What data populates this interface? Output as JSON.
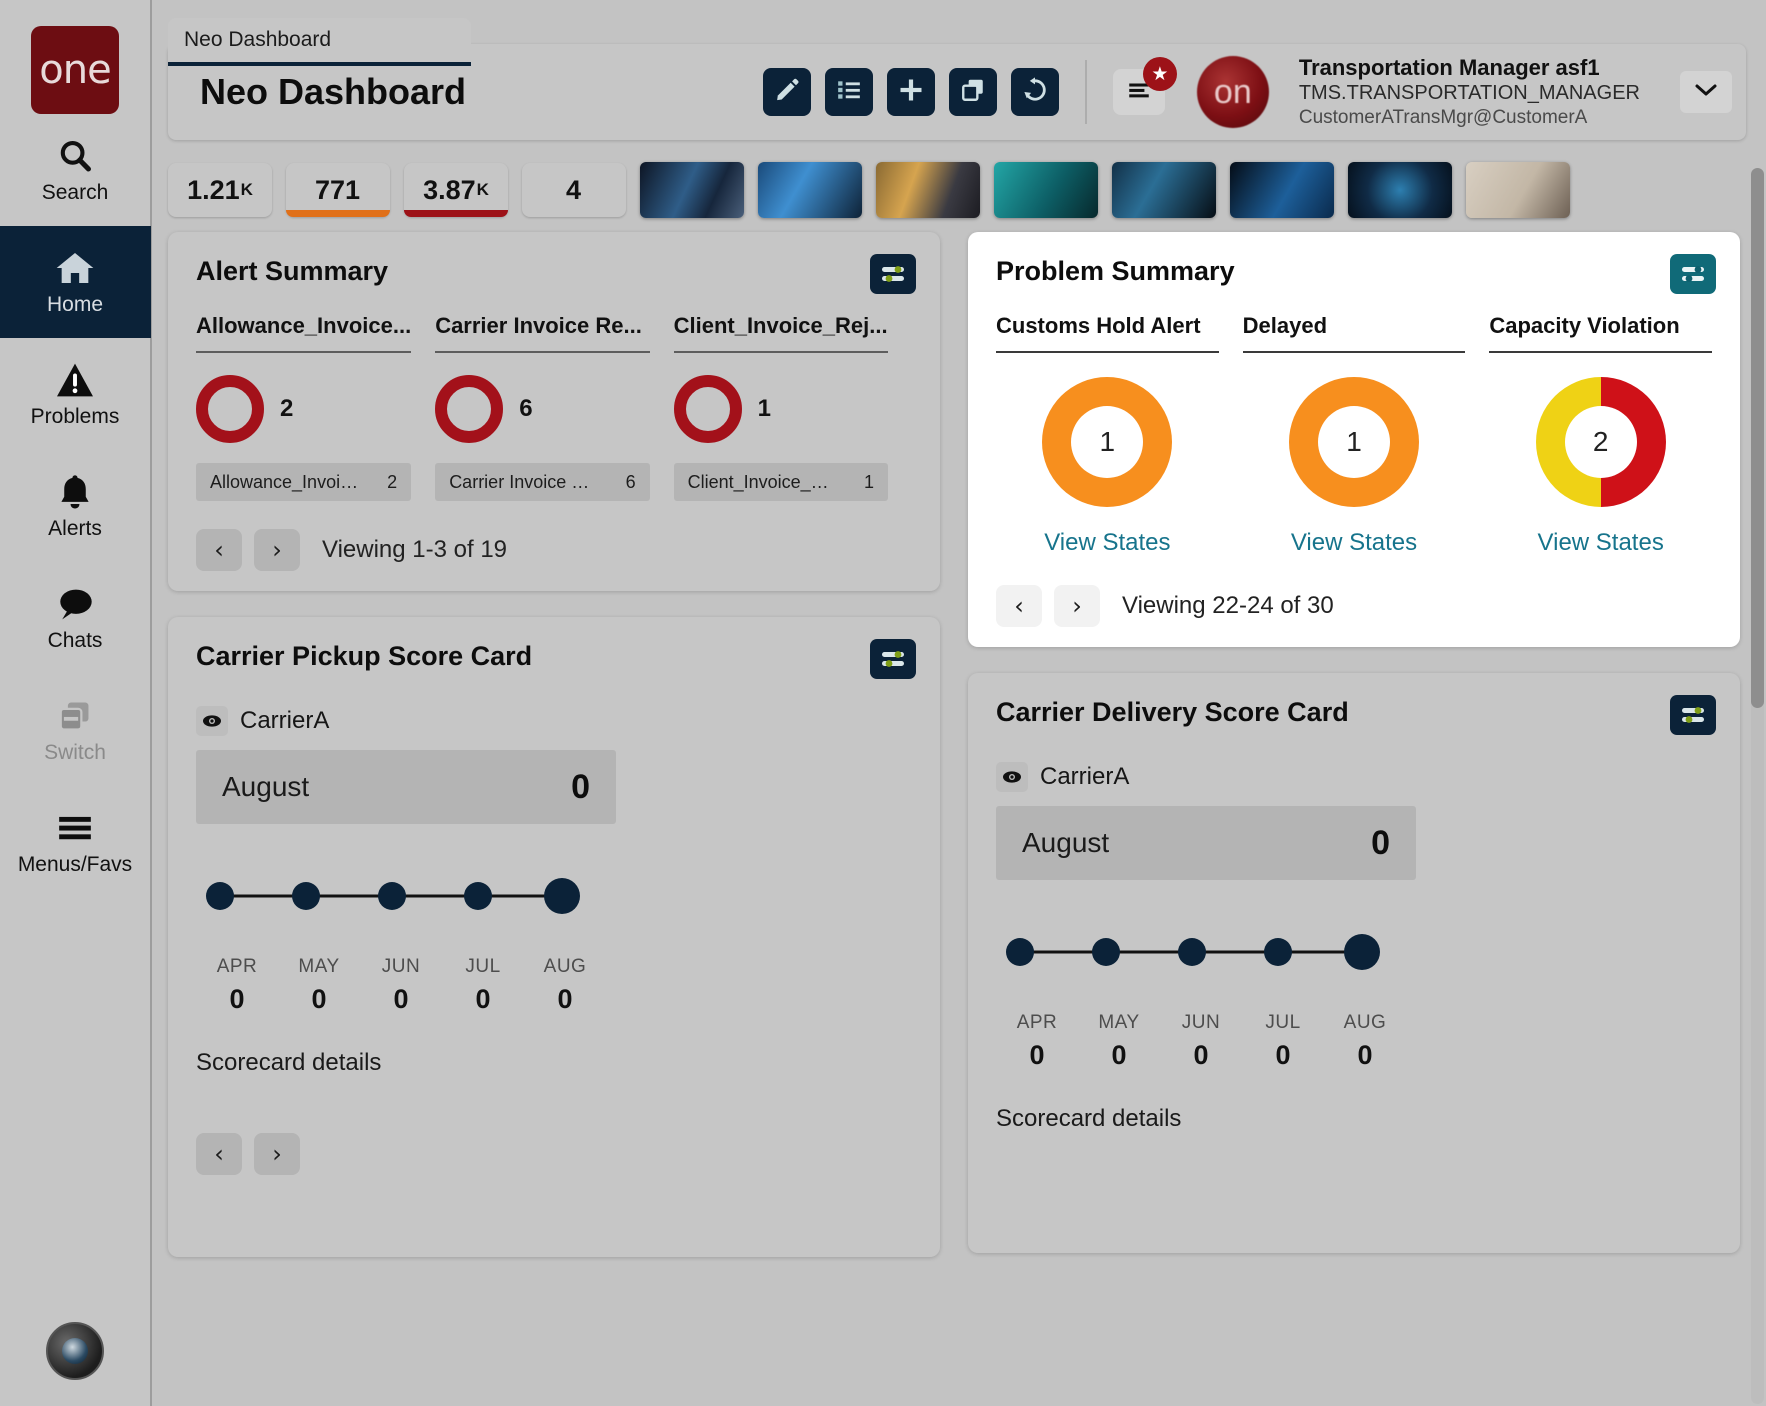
{
  "brand": {
    "logo_text": "one"
  },
  "rail": {
    "items": [
      {
        "label": "Search",
        "icon": "search-icon",
        "state": "normal"
      },
      {
        "label": "Home",
        "icon": "home-icon",
        "state": "active"
      },
      {
        "label": "Problems",
        "icon": "warning-icon",
        "state": "normal"
      },
      {
        "label": "Alerts",
        "icon": "bell-icon",
        "state": "normal"
      },
      {
        "label": "Chats",
        "icon": "chat-icon",
        "state": "normal"
      },
      {
        "label": "Switch",
        "icon": "switch-icon",
        "state": "disabled"
      },
      {
        "label": "Menus/Favs",
        "icon": "hamburger-icon",
        "state": "normal"
      }
    ]
  },
  "tab": {
    "label": "Neo Dashboard"
  },
  "header": {
    "title": "Neo Dashboard",
    "tools": [
      {
        "name": "edit-button",
        "icon": "pencil-icon"
      },
      {
        "name": "list-button",
        "icon": "list-icon"
      },
      {
        "name": "add-button",
        "icon": "plus-icon"
      },
      {
        "name": "copy-button",
        "icon": "copy-icon"
      },
      {
        "name": "refresh-button",
        "icon": "refresh-icon"
      }
    ],
    "menu_badge": "★",
    "user": {
      "avatar_text": "on",
      "name": "Transportation Manager asf1",
      "role": "TMS.TRANSPORTATION_MANAGER",
      "login": "CustomerATransMgr@CustomerA"
    }
  },
  "kpis": [
    {
      "value": "1.21",
      "unit": "K",
      "accent": ""
    },
    {
      "value": "771",
      "unit": "",
      "accent": "#e0701a"
    },
    {
      "value": "3.87",
      "unit": "K",
      "accent": "#9d1218"
    },
    {
      "value": "4",
      "unit": "",
      "accent": ""
    }
  ],
  "thumbnails": [
    {
      "name": "thumb-truck-tunnel",
      "colors": [
        "#16263c",
        "#2f5d88",
        "#0d1524"
      ]
    },
    {
      "name": "thumb-iot-network",
      "colors": [
        "#1a4a7a",
        "#3f8fd0",
        "#0e2237"
      ]
    },
    {
      "name": "thumb-warehouse-scan",
      "colors": [
        "#8a6a33",
        "#d6a44f",
        "#1c1c22"
      ]
    },
    {
      "name": "thumb-global-logistics",
      "colors": [
        "#0d5f66",
        "#23a6a6",
        "#07282c"
      ]
    },
    {
      "name": "thumb-cyber-lock",
      "colors": [
        "#123047",
        "#2b6e95",
        "#060d14"
      ]
    },
    {
      "name": "thumb-data-blue",
      "colors": [
        "#0a2a4c",
        "#1d5f9a",
        "#040c16"
      ]
    },
    {
      "name": "thumb-person-circuit",
      "colors": [
        "#102b46",
        "#2d7fb0",
        "#05101c"
      ]
    },
    {
      "name": "thumb-silhouette-beige",
      "colors": [
        "#d8cfc2",
        "#a89782",
        "#6d6054"
      ]
    }
  ],
  "alert_summary": {
    "title": "Alert Summary",
    "config_icon": "sliders-icon",
    "metrics": [
      {
        "header": "Allowance_Invoice...",
        "value": "2",
        "chip_name": "Allowance_Invoic...",
        "chip_value": "2",
        "ring_color": "#a3111a"
      },
      {
        "header": "Carrier Invoice Re...",
        "value": "6",
        "chip_name": "Carrier Invoice Re...",
        "chip_value": "6",
        "ring_color": "#a3111a"
      },
      {
        "header": "Client_Invoice_Rej...",
        "value": "1",
        "chip_name": "Client_Invoice_Re...",
        "chip_value": "1",
        "ring_color": "#a3111a"
      }
    ],
    "pager": {
      "prev": "‹",
      "next": "›",
      "text": "Viewing 1-3 of 19"
    }
  },
  "problem_summary": {
    "title": "Problem Summary",
    "config_icon": "sliders-icon",
    "metrics": [
      {
        "header": "Customs Hold Alert",
        "value": "1",
        "link": "View States",
        "segments": [
          {
            "color": "#f78f1e",
            "pct": 100
          }
        ]
      },
      {
        "header": "Delayed",
        "value": "1",
        "link": "View States",
        "segments": [
          {
            "color": "#f78f1e",
            "pct": 100
          }
        ]
      },
      {
        "header": "Capacity Violation",
        "value": "2",
        "link": "View States",
        "segments": [
          {
            "color": "#cf1118",
            "pct": 50
          },
          {
            "color": "#efd215",
            "pct": 50
          }
        ]
      }
    ],
    "pager": {
      "prev": "‹",
      "next": "›",
      "text": "Viewing 22-24 of 30"
    }
  },
  "pickup_scorecard": {
    "title": "Carrier Pickup Score Card",
    "config_icon": "sliders-icon",
    "legend": {
      "icon": "eye-icon",
      "label": "CarrierA"
    },
    "current": {
      "month": "August",
      "value": "0"
    },
    "details_link": "Scorecard details",
    "pager": {
      "prev": "‹",
      "next": "›"
    },
    "chart_data": {
      "type": "line",
      "title": "Carrier Pickup Score Card",
      "categories": [
        "APR",
        "MAY",
        "JUN",
        "JUL",
        "AUG"
      ],
      "values": [
        0,
        0,
        0,
        0,
        0
      ],
      "series": [
        {
          "name": "CarrierA",
          "values": [
            0,
            0,
            0,
            0,
            0
          ]
        }
      ],
      "xlabel": "",
      "ylabel": "",
      "ylim": [
        0,
        0
      ],
      "grid": false,
      "legend_position": "top-left",
      "marker_color": "#0b2238",
      "line_color": "#111111"
    }
  },
  "delivery_scorecard": {
    "title": "Carrier Delivery Score Card",
    "config_icon": "sliders-icon",
    "legend": {
      "icon": "eye-icon",
      "label": "CarrierA"
    },
    "current": {
      "month": "August",
      "value": "0"
    },
    "details_link": "Scorecard details",
    "chart_data": {
      "type": "line",
      "title": "Carrier Delivery Score Card",
      "categories": [
        "APR",
        "MAY",
        "JUN",
        "JUL",
        "AUG"
      ],
      "values": [
        0,
        0,
        0,
        0,
        0
      ],
      "series": [
        {
          "name": "CarrierA",
          "values": [
            0,
            0,
            0,
            0,
            0
          ]
        }
      ],
      "xlabel": "",
      "ylabel": "",
      "ylim": [
        0,
        0
      ],
      "grid": false,
      "legend_position": "top-left",
      "marker_color": "#0b2238",
      "line_color": "#111111"
    }
  },
  "colors": {
    "brand_dark_red": "#6d0d12",
    "navy": "#0b2238",
    "orange": "#f78f1e",
    "red": "#cf1118",
    "yellow": "#efd215",
    "teal_link": "#17748c",
    "panel_bg": "#c6c6c6"
  }
}
